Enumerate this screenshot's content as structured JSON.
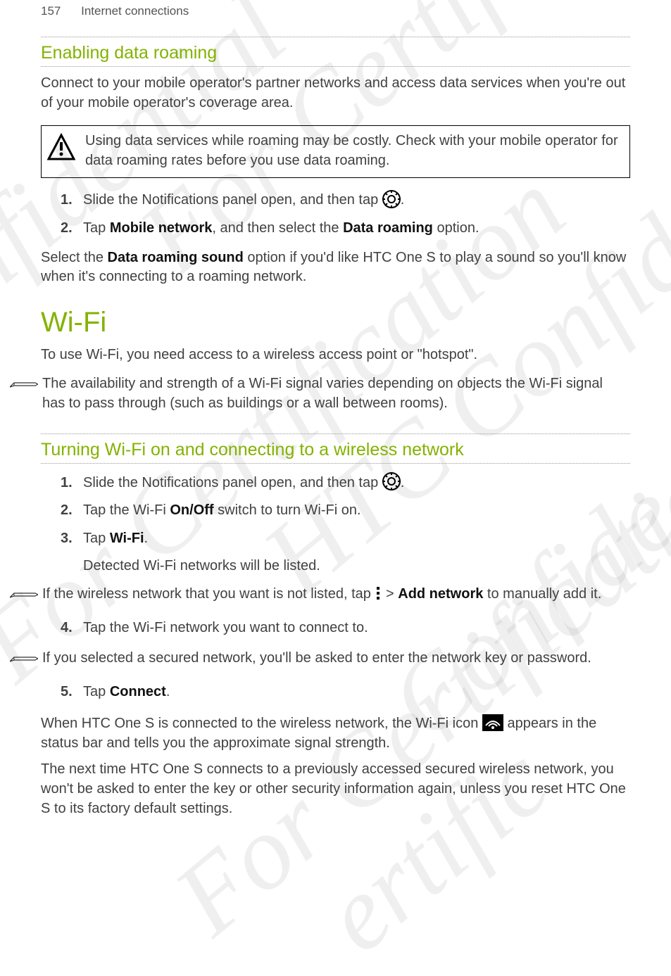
{
  "page": {
    "number": "157",
    "section": "Internet connections"
  },
  "roaming": {
    "title": "Enabling data roaming",
    "intro": "Connect to your mobile operator's partner networks and access data services when you're out of your mobile operator's coverage area.",
    "warning": "Using data services while roaming may be costly. Check with your mobile operator for data roaming rates before you use data roaming.",
    "step1_pre": "Slide the Notifications panel open, and then tap ",
    "step1_post": ".",
    "step2_a": "Tap ",
    "step2_b": "Mobile network",
    "step2_c": ", and then select the ",
    "step2_d": "Data roaming",
    "step2_e": " option.",
    "outro_a": "Select the ",
    "outro_b": "Data roaming sound",
    "outro_c": " option if you'd like HTC One S to play a sound so you'll know when it's connecting to a roaming network."
  },
  "wifi": {
    "title": "Wi-Fi",
    "intro": "To use Wi-Fi, you need access to a wireless access point or \"hotspot\".",
    "note1": "The availability and strength of a Wi-Fi signal varies depending on objects the Wi-Fi signal has to pass through (such as buildings or a wall between rooms).",
    "sub_title": "Turning Wi-Fi on and connecting to a wireless network",
    "step1_pre": "Slide the Notifications panel open, and then tap ",
    "step1_post": ".",
    "step2_a": "Tap the Wi-Fi ",
    "step2_b": "On/Off",
    "step2_c": " switch to turn Wi-Fi on.",
    "step3_a": "Tap ",
    "step3_b": "Wi-Fi",
    "step3_c": ".",
    "step3_d": "Detected Wi-Fi networks will be listed.",
    "note2_a": "If the wireless network that you want is not listed, tap ",
    "note2_b": " > ",
    "note2_c": "Add network",
    "note2_d": " to manually add it.",
    "step4": "Tap the Wi-Fi network you want to connect to.",
    "note3": "If you selected a secured network, you'll be asked to enter the network key or password.",
    "step5_a": "Tap ",
    "step5_b": "Connect",
    "step5_c": ".",
    "outro1_a": "When HTC One S is connected to the wireless network, the Wi-Fi icon ",
    "outro1_b": " appears in the status bar and tells you the approximate signal strength.",
    "outro2": "The next time HTC One S connects to a previously accessed secured wireless network, you won't be asked to enter the key or other security information again, unless you reset HTC One S to its factory default settings."
  }
}
